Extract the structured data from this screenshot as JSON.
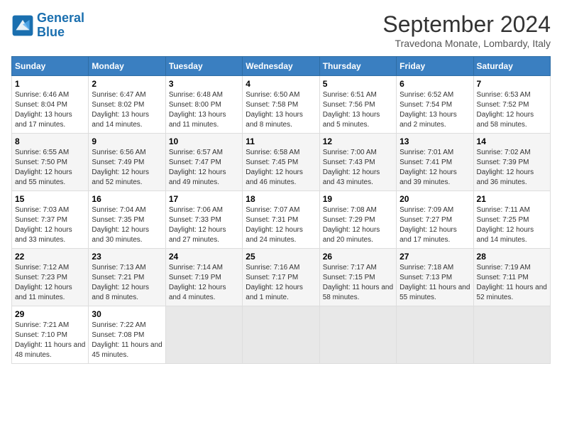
{
  "header": {
    "logo_line1": "General",
    "logo_line2": "Blue",
    "title": "September 2024",
    "subtitle": "Travedona Monate, Lombardy, Italy"
  },
  "columns": [
    "Sunday",
    "Monday",
    "Tuesday",
    "Wednesday",
    "Thursday",
    "Friday",
    "Saturday"
  ],
  "weeks": [
    [
      {
        "day": "1",
        "info": "Sunrise: 6:46 AM\nSunset: 8:04 PM\nDaylight: 13 hours and 17 minutes."
      },
      {
        "day": "2",
        "info": "Sunrise: 6:47 AM\nSunset: 8:02 PM\nDaylight: 13 hours and 14 minutes."
      },
      {
        "day": "3",
        "info": "Sunrise: 6:48 AM\nSunset: 8:00 PM\nDaylight: 13 hours and 11 minutes."
      },
      {
        "day": "4",
        "info": "Sunrise: 6:50 AM\nSunset: 7:58 PM\nDaylight: 13 hours and 8 minutes."
      },
      {
        "day": "5",
        "info": "Sunrise: 6:51 AM\nSunset: 7:56 PM\nDaylight: 13 hours and 5 minutes."
      },
      {
        "day": "6",
        "info": "Sunrise: 6:52 AM\nSunset: 7:54 PM\nDaylight: 13 hours and 2 minutes."
      },
      {
        "day": "7",
        "info": "Sunrise: 6:53 AM\nSunset: 7:52 PM\nDaylight: 12 hours and 58 minutes."
      }
    ],
    [
      {
        "day": "8",
        "info": "Sunrise: 6:55 AM\nSunset: 7:50 PM\nDaylight: 12 hours and 55 minutes."
      },
      {
        "day": "9",
        "info": "Sunrise: 6:56 AM\nSunset: 7:49 PM\nDaylight: 12 hours and 52 minutes."
      },
      {
        "day": "10",
        "info": "Sunrise: 6:57 AM\nSunset: 7:47 PM\nDaylight: 12 hours and 49 minutes."
      },
      {
        "day": "11",
        "info": "Sunrise: 6:58 AM\nSunset: 7:45 PM\nDaylight: 12 hours and 46 minutes."
      },
      {
        "day": "12",
        "info": "Sunrise: 7:00 AM\nSunset: 7:43 PM\nDaylight: 12 hours and 43 minutes."
      },
      {
        "day": "13",
        "info": "Sunrise: 7:01 AM\nSunset: 7:41 PM\nDaylight: 12 hours and 39 minutes."
      },
      {
        "day": "14",
        "info": "Sunrise: 7:02 AM\nSunset: 7:39 PM\nDaylight: 12 hours and 36 minutes."
      }
    ],
    [
      {
        "day": "15",
        "info": "Sunrise: 7:03 AM\nSunset: 7:37 PM\nDaylight: 12 hours and 33 minutes."
      },
      {
        "day": "16",
        "info": "Sunrise: 7:04 AM\nSunset: 7:35 PM\nDaylight: 12 hours and 30 minutes."
      },
      {
        "day": "17",
        "info": "Sunrise: 7:06 AM\nSunset: 7:33 PM\nDaylight: 12 hours and 27 minutes."
      },
      {
        "day": "18",
        "info": "Sunrise: 7:07 AM\nSunset: 7:31 PM\nDaylight: 12 hours and 24 minutes."
      },
      {
        "day": "19",
        "info": "Sunrise: 7:08 AM\nSunset: 7:29 PM\nDaylight: 12 hours and 20 minutes."
      },
      {
        "day": "20",
        "info": "Sunrise: 7:09 AM\nSunset: 7:27 PM\nDaylight: 12 hours and 17 minutes."
      },
      {
        "day": "21",
        "info": "Sunrise: 7:11 AM\nSunset: 7:25 PM\nDaylight: 12 hours and 14 minutes."
      }
    ],
    [
      {
        "day": "22",
        "info": "Sunrise: 7:12 AM\nSunset: 7:23 PM\nDaylight: 12 hours and 11 minutes."
      },
      {
        "day": "23",
        "info": "Sunrise: 7:13 AM\nSunset: 7:21 PM\nDaylight: 12 hours and 8 minutes."
      },
      {
        "day": "24",
        "info": "Sunrise: 7:14 AM\nSunset: 7:19 PM\nDaylight: 12 hours and 4 minutes."
      },
      {
        "day": "25",
        "info": "Sunrise: 7:16 AM\nSunset: 7:17 PM\nDaylight: 12 hours and 1 minute."
      },
      {
        "day": "26",
        "info": "Sunrise: 7:17 AM\nSunset: 7:15 PM\nDaylight: 11 hours and 58 minutes."
      },
      {
        "day": "27",
        "info": "Sunrise: 7:18 AM\nSunset: 7:13 PM\nDaylight: 11 hours and 55 minutes."
      },
      {
        "day": "28",
        "info": "Sunrise: 7:19 AM\nSunset: 7:11 PM\nDaylight: 11 hours and 52 minutes."
      }
    ],
    [
      {
        "day": "29",
        "info": "Sunrise: 7:21 AM\nSunset: 7:10 PM\nDaylight: 11 hours and 48 minutes."
      },
      {
        "day": "30",
        "info": "Sunrise: 7:22 AM\nSunset: 7:08 PM\nDaylight: 11 hours and 45 minutes."
      },
      {
        "day": "",
        "info": ""
      },
      {
        "day": "",
        "info": ""
      },
      {
        "day": "",
        "info": ""
      },
      {
        "day": "",
        "info": ""
      },
      {
        "day": "",
        "info": ""
      }
    ]
  ]
}
